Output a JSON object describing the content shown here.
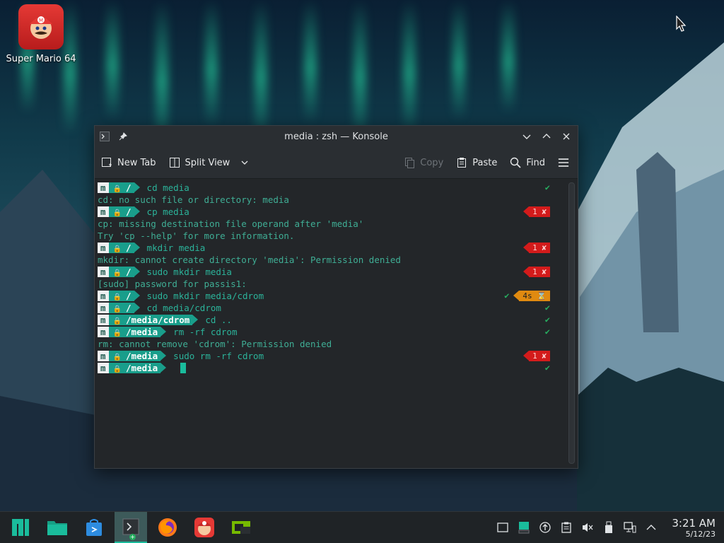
{
  "desktop": {
    "icons": [
      {
        "label": "Super Mario 64",
        "icon": "mario-icon"
      }
    ]
  },
  "window": {
    "title": "media : zsh — Konsole",
    "toolbar": {
      "new_tab": "New Tab",
      "split_view": "Split View",
      "copy": "Copy",
      "paste": "Paste",
      "find": "Find"
    }
  },
  "terminal": {
    "lines": [
      {
        "kind": "prompt",
        "path": "/",
        "highlight": false,
        "cmd": "cd media",
        "status": "ok"
      },
      {
        "kind": "out",
        "text": "cd: no such file or directory: media"
      },
      {
        "kind": "prompt",
        "path": "/",
        "highlight": false,
        "cmd": "cp media",
        "status": "err",
        "code": "1"
      },
      {
        "kind": "out",
        "text": "cp: missing destination file operand after 'media'"
      },
      {
        "kind": "out",
        "text": "Try 'cp --help' for more information."
      },
      {
        "kind": "prompt",
        "path": "/",
        "highlight": false,
        "cmd": "mkdir media",
        "status": "err",
        "code": "1"
      },
      {
        "kind": "out",
        "text": "mkdir: cannot create directory 'media': Permission denied"
      },
      {
        "kind": "prompt",
        "path": "/",
        "highlight": false,
        "cmd": "sudo mkdir media",
        "status": "err",
        "code": "1"
      },
      {
        "kind": "out",
        "text": "[sudo] password for passis1:"
      },
      {
        "kind": "prompt",
        "path": "/",
        "highlight": false,
        "cmd": "sudo mkdir media/cdrom",
        "status": "time",
        "time": "4s"
      },
      {
        "kind": "prompt",
        "path": "/",
        "highlight": false,
        "cmd": "cd media/cdrom",
        "status": "ok"
      },
      {
        "kind": "prompt",
        "path": "/media/cdrom",
        "highlight": true,
        "cmd": "cd ..",
        "status": "ok"
      },
      {
        "kind": "prompt",
        "path": "/media",
        "highlight": true,
        "cmd": "rm -rf cdrom",
        "status": "ok"
      },
      {
        "kind": "out",
        "text": "rm: cannot remove 'cdrom': Permission denied"
      },
      {
        "kind": "prompt",
        "path": "/media",
        "highlight": true,
        "cmd": "sudo rm -rf cdrom",
        "status": "err",
        "code": "1"
      },
      {
        "kind": "prompt",
        "path": "/media",
        "highlight": true,
        "cmd": "",
        "status": "ok",
        "cursor": true
      }
    ]
  },
  "taskbar": {
    "apps": [
      "manjaro-menu-icon",
      "file-manager-icon",
      "software-store-icon",
      "konsole-icon",
      "firefox-icon",
      "super-mario-icon",
      "nvidia-icon"
    ],
    "active_index": 3,
    "clock": {
      "time": "3:21 AM",
      "date": "5/12/23"
    }
  },
  "colors": {
    "accent": "#1abc9c",
    "error": "#d31b1b",
    "timer": "#e08a10",
    "terminal_bg": "#232629"
  }
}
